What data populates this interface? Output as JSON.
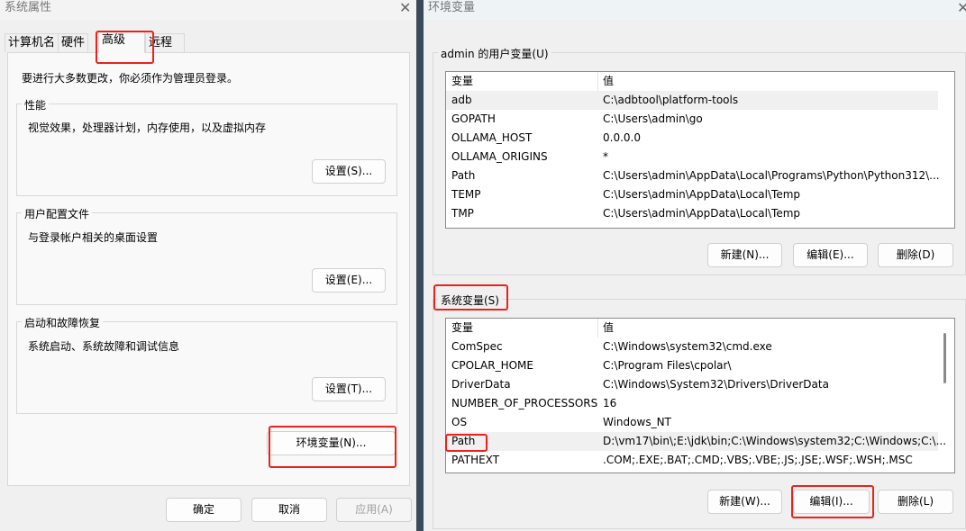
{
  "system_properties": {
    "title": "系统属性",
    "tabs": [
      {
        "label": "计算机名"
      },
      {
        "label": "硬件"
      },
      {
        "label": "高级",
        "active": true
      },
      {
        "label": "远程"
      }
    ],
    "admin_notice": "要进行大多数更改，你必须作为管理员登录。",
    "groups": [
      {
        "label": "性能",
        "description": "视觉效果，处理器计划，内存使用，以及虚拟内存",
        "button": "设置(S)..."
      },
      {
        "label": "用户配置文件",
        "description": "与登录帐户相关的桌面设置",
        "button": "设置(E)..."
      },
      {
        "label": "启动和故障恢复",
        "description": "系统启动、系统故障和调试信息",
        "button": "设置(T)..."
      }
    ],
    "env_button": "环境变量(N)...",
    "ok": "确定",
    "cancel": "取消",
    "apply": "应用(A)"
  },
  "env_vars": {
    "title": "环境变量",
    "user_group": "admin 的用户变量(U)",
    "col_var": "变量",
    "col_val": "值",
    "user_vars": [
      {
        "name": "adb",
        "value": "C:\\adbtool\\platform-tools"
      },
      {
        "name": "GOPATH",
        "value": "C:\\Users\\admin\\go"
      },
      {
        "name": "OLLAMA_HOST",
        "value": "0.0.0.0"
      },
      {
        "name": "OLLAMA_ORIGINS",
        "value": "*"
      },
      {
        "name": "Path",
        "value": "C:\\Users\\admin\\AppData\\Local\\Programs\\Python\\Python312\\..."
      },
      {
        "name": "TEMP",
        "value": "C:\\Users\\admin\\AppData\\Local\\Temp"
      },
      {
        "name": "TMP",
        "value": "C:\\Users\\admin\\AppData\\Local\\Temp"
      }
    ],
    "user_buttons": {
      "new": "新建(N)...",
      "edit": "编辑(E)...",
      "delete": "删除(D)"
    },
    "system_group": "系统变量(S)",
    "system_vars": [
      {
        "name": "ComSpec",
        "value": "C:\\Windows\\system32\\cmd.exe"
      },
      {
        "name": "CPOLAR_HOME",
        "value": "C:\\Program Files\\cpolar\\"
      },
      {
        "name": "DriverData",
        "value": "C:\\Windows\\System32\\Drivers\\DriverData"
      },
      {
        "name": "NUMBER_OF_PROCESSORS",
        "value": "16"
      },
      {
        "name": "OS",
        "value": "Windows_NT"
      },
      {
        "name": "Path",
        "value": "D:\\vm17\\bin\\;E:\\jdk\\bin;C:\\Windows\\system32;C:\\Windows;C:\\..."
      },
      {
        "name": "PATHEXT",
        "value": ".COM;.EXE;.BAT;.CMD;.VBS;.VBE;.JS;.JSE;.WSF;.WSH;.MSC"
      }
    ],
    "system_buttons": {
      "new": "新建(W)...",
      "edit": "编辑(I)...",
      "delete": "删除(L)"
    }
  },
  "colors": {
    "highlight": "#e8231d",
    "selected_row": "#f0f0f0"
  }
}
